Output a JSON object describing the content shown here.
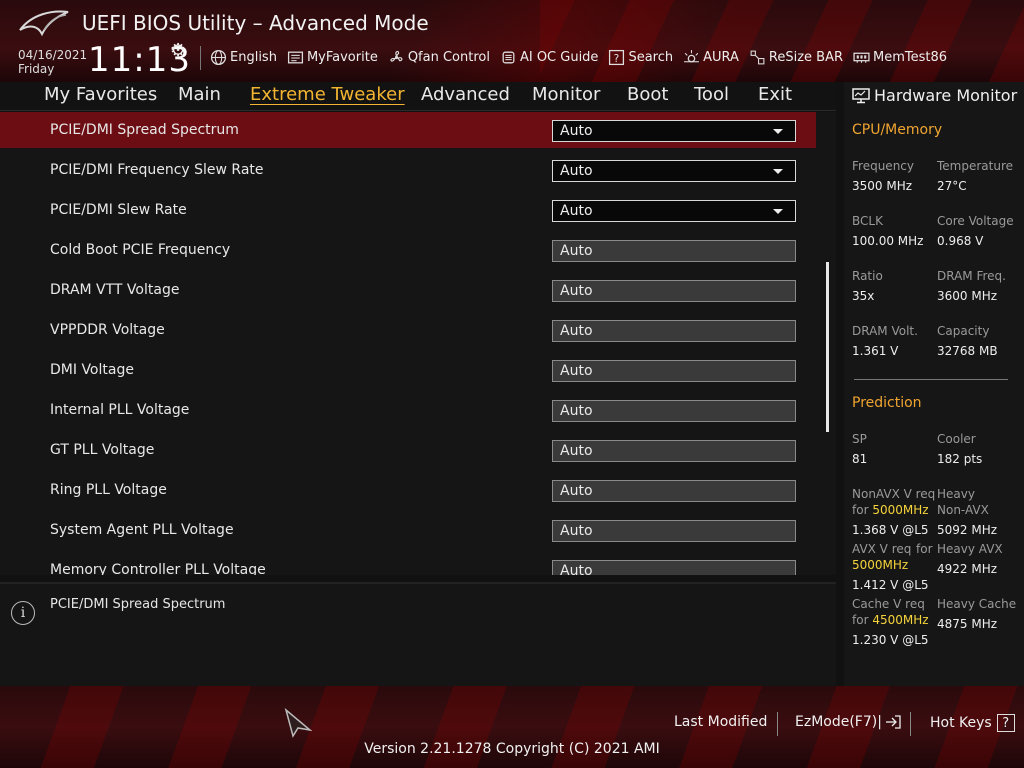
{
  "header": {
    "title": "UEFI BIOS Utility – Advanced Mode",
    "date": "04/16/2021",
    "day": "Friday",
    "time": "11:13",
    "tools": [
      {
        "label": "English",
        "icon": "globe-icon"
      },
      {
        "label": "MyFavorite",
        "icon": "favorite-list-icon"
      },
      {
        "label": "Qfan Control",
        "icon": "fan-icon"
      },
      {
        "label": "AI OC Guide",
        "icon": "chip-icon"
      },
      {
        "label": "Search",
        "icon": "search-icon"
      },
      {
        "label": "AURA",
        "icon": "aura-icon"
      },
      {
        "label": "ReSize BAR",
        "icon": "resize-bar-icon"
      },
      {
        "label": "MemTest86",
        "icon": "memory-icon"
      }
    ]
  },
  "nav": {
    "tabs": [
      "My Favorites",
      "Main",
      "Extreme Tweaker",
      "Advanced",
      "Monitor",
      "Boot",
      "Tool",
      "Exit"
    ],
    "active": "Extreme Tweaker"
  },
  "settings": [
    {
      "label": "PCIE/DMI Spread Spectrum",
      "value": "Auto",
      "type": "dropdown"
    },
    {
      "label": "PCIE/DMI Frequency Slew Rate",
      "value": "Auto",
      "type": "dropdown"
    },
    {
      "label": "PCIE/DMI Slew Rate",
      "value": "Auto",
      "type": "dropdown"
    },
    {
      "label": "Cold Boot PCIE Frequency",
      "value": "Auto",
      "type": "field"
    },
    {
      "label": "DRAM VTT Voltage",
      "value": "Auto",
      "type": "field"
    },
    {
      "label": "VPPDDR Voltage",
      "value": "Auto",
      "type": "field"
    },
    {
      "label": "DMI Voltage",
      "value": "Auto",
      "type": "field"
    },
    {
      "label": "Internal PLL Voltage",
      "value": "Auto",
      "type": "field"
    },
    {
      "label": "GT PLL Voltage",
      "value": "Auto",
      "type": "field"
    },
    {
      "label": "Ring PLL Voltage",
      "value": "Auto",
      "type": "field"
    },
    {
      "label": "System Agent PLL Voltage",
      "value": "Auto",
      "type": "field"
    },
    {
      "label": "Memory Controller PLL Voltage",
      "value": "Auto",
      "type": "field"
    }
  ],
  "info": {
    "text": "PCIE/DMI Spread Spectrum"
  },
  "hw_monitor": {
    "title": "Hardware Monitor",
    "cpu_memory": {
      "title": "CPU/Memory",
      "frequency_label": "Frequency",
      "frequency": "3500 MHz",
      "temperature_label": "Temperature",
      "temperature": "27°C",
      "bclk_label": "BCLK",
      "bclk": "100.00 MHz",
      "core_voltage_label": "Core Voltage",
      "core_voltage": "0.968 V",
      "ratio_label": "Ratio",
      "ratio": "35x",
      "dram_freq_label": "DRAM Freq.",
      "dram_freq": "3600 MHz",
      "dram_volt_label": "DRAM Volt.",
      "dram_volt": "1.361 V",
      "capacity_label": "Capacity",
      "capacity": "32768 MB"
    },
    "prediction": {
      "title": "Prediction",
      "sp_label": "SP",
      "sp": "81",
      "cooler_label": "Cooler",
      "cooler": "182 pts",
      "nonavx_label_a": "NonAVX V req",
      "nonavx_label_b": "for",
      "nonavx_freq": "5000MHz",
      "nonavx_v": "1.368 V @L5",
      "heavy_nonavx_label_a": "Heavy",
      "heavy_nonavx_label_b": "Non-AVX",
      "heavy_nonavx": "5092 MHz",
      "avx_label_a": "AVX V req",
      "avx_label_b": "for",
      "avx_freq": "5000MHz",
      "avx_v": "1.412 V @L5",
      "heavy_avx_label": "Heavy AVX",
      "heavy_avx": "4922 MHz",
      "cache_label_a": "Cache V req",
      "cache_label_b": "for",
      "cache_freq": "4500MHz",
      "cache_v": "1.230 V @L5",
      "heavy_cache_label": "Heavy Cache",
      "heavy_cache": "4875 MHz"
    }
  },
  "footer": {
    "last_modified": "Last Modified",
    "ezmode": "EzMode(F7)|",
    "hotkeys": "Hot Keys",
    "hotkeys_key": "?",
    "version": "Version 2.21.1278 Copyright (C) 2021 AMI"
  },
  "colors": {
    "accent": "#f3b531",
    "selected_row": "#6b0d12",
    "highlight": "#f5d33a"
  }
}
